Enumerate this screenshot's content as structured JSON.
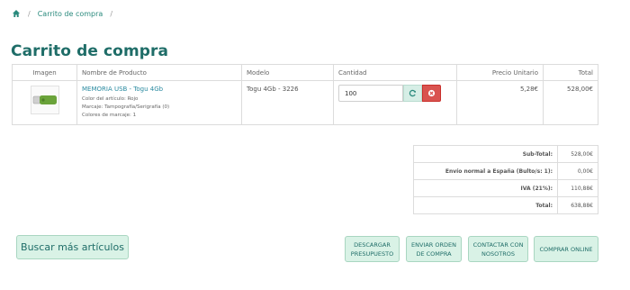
{
  "breadcrumb": {
    "sep": "/",
    "current": "Carrito de compra"
  },
  "page": {
    "title": "Carrito de compra"
  },
  "table": {
    "headers": [
      "Imagen",
      "Nombre de Producto",
      "Modelo",
      "Cantidad",
      "Precio Unitario",
      "Total"
    ],
    "row": {
      "name": "MEMORIA USB - Togu 4Gb",
      "meta": [
        "Color del artículo: Rojo",
        "Marcaje: Tampografía/Serigrafía (0)",
        "Colores de marcaje: 1"
      ],
      "model": "Togu 4Gb - 3226",
      "quantity": "100",
      "unit_price": "5,28€",
      "total": "528,00€"
    }
  },
  "totals": [
    {
      "label": "Sub-Total:",
      "value": "528,00€"
    },
    {
      "label": "Envío normal a España (Bulto/s: 1):",
      "value": "0,00€"
    },
    {
      "label": "IVA (21%):",
      "value": "110,88€"
    },
    {
      "label": "Total:",
      "value": "638,88€"
    }
  ],
  "buttons": {
    "continue": "Buscar más artículos",
    "download": [
      "DESCARGAR",
      "PRESUPUESTO"
    ],
    "order": [
      "ENVIAR ORDEN",
      "DE COMPRA"
    ],
    "contact": [
      "CONTACTAR CON",
      "NOSOTROS"
    ],
    "buy": "COMPRAR ONLINE"
  },
  "colors": {
    "accent": "#1f6d68",
    "link": "#2a8aa0",
    "button_bg": "#d9f2e6",
    "danger": "#d9534f"
  },
  "icons": {
    "home": "home-icon",
    "refresh": "refresh-icon",
    "remove": "remove-icon",
    "product": "usb-thumbnail"
  }
}
